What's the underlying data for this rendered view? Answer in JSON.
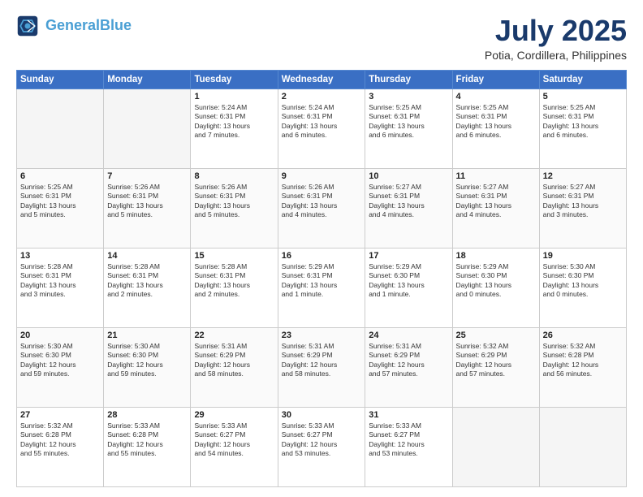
{
  "header": {
    "logo_line1": "General",
    "logo_line2": "Blue",
    "month": "July 2025",
    "location": "Potia, Cordillera, Philippines"
  },
  "days_of_week": [
    "Sunday",
    "Monday",
    "Tuesday",
    "Wednesday",
    "Thursday",
    "Friday",
    "Saturday"
  ],
  "weeks": [
    [
      {
        "day": "",
        "info": ""
      },
      {
        "day": "",
        "info": ""
      },
      {
        "day": "1",
        "info": "Sunrise: 5:24 AM\nSunset: 6:31 PM\nDaylight: 13 hours\nand 7 minutes."
      },
      {
        "day": "2",
        "info": "Sunrise: 5:24 AM\nSunset: 6:31 PM\nDaylight: 13 hours\nand 6 minutes."
      },
      {
        "day": "3",
        "info": "Sunrise: 5:25 AM\nSunset: 6:31 PM\nDaylight: 13 hours\nand 6 minutes."
      },
      {
        "day": "4",
        "info": "Sunrise: 5:25 AM\nSunset: 6:31 PM\nDaylight: 13 hours\nand 6 minutes."
      },
      {
        "day": "5",
        "info": "Sunrise: 5:25 AM\nSunset: 6:31 PM\nDaylight: 13 hours\nand 6 minutes."
      }
    ],
    [
      {
        "day": "6",
        "info": "Sunrise: 5:25 AM\nSunset: 6:31 PM\nDaylight: 13 hours\nand 5 minutes."
      },
      {
        "day": "7",
        "info": "Sunrise: 5:26 AM\nSunset: 6:31 PM\nDaylight: 13 hours\nand 5 minutes."
      },
      {
        "day": "8",
        "info": "Sunrise: 5:26 AM\nSunset: 6:31 PM\nDaylight: 13 hours\nand 5 minutes."
      },
      {
        "day": "9",
        "info": "Sunrise: 5:26 AM\nSunset: 6:31 PM\nDaylight: 13 hours\nand 4 minutes."
      },
      {
        "day": "10",
        "info": "Sunrise: 5:27 AM\nSunset: 6:31 PM\nDaylight: 13 hours\nand 4 minutes."
      },
      {
        "day": "11",
        "info": "Sunrise: 5:27 AM\nSunset: 6:31 PM\nDaylight: 13 hours\nand 4 minutes."
      },
      {
        "day": "12",
        "info": "Sunrise: 5:27 AM\nSunset: 6:31 PM\nDaylight: 13 hours\nand 3 minutes."
      }
    ],
    [
      {
        "day": "13",
        "info": "Sunrise: 5:28 AM\nSunset: 6:31 PM\nDaylight: 13 hours\nand 3 minutes."
      },
      {
        "day": "14",
        "info": "Sunrise: 5:28 AM\nSunset: 6:31 PM\nDaylight: 13 hours\nand 2 minutes."
      },
      {
        "day": "15",
        "info": "Sunrise: 5:28 AM\nSunset: 6:31 PM\nDaylight: 13 hours\nand 2 minutes."
      },
      {
        "day": "16",
        "info": "Sunrise: 5:29 AM\nSunset: 6:31 PM\nDaylight: 13 hours\nand 1 minute."
      },
      {
        "day": "17",
        "info": "Sunrise: 5:29 AM\nSunset: 6:30 PM\nDaylight: 13 hours\nand 1 minute."
      },
      {
        "day": "18",
        "info": "Sunrise: 5:29 AM\nSunset: 6:30 PM\nDaylight: 13 hours\nand 0 minutes."
      },
      {
        "day": "19",
        "info": "Sunrise: 5:30 AM\nSunset: 6:30 PM\nDaylight: 13 hours\nand 0 minutes."
      }
    ],
    [
      {
        "day": "20",
        "info": "Sunrise: 5:30 AM\nSunset: 6:30 PM\nDaylight: 12 hours\nand 59 minutes."
      },
      {
        "day": "21",
        "info": "Sunrise: 5:30 AM\nSunset: 6:30 PM\nDaylight: 12 hours\nand 59 minutes."
      },
      {
        "day": "22",
        "info": "Sunrise: 5:31 AM\nSunset: 6:29 PM\nDaylight: 12 hours\nand 58 minutes."
      },
      {
        "day": "23",
        "info": "Sunrise: 5:31 AM\nSunset: 6:29 PM\nDaylight: 12 hours\nand 58 minutes."
      },
      {
        "day": "24",
        "info": "Sunrise: 5:31 AM\nSunset: 6:29 PM\nDaylight: 12 hours\nand 57 minutes."
      },
      {
        "day": "25",
        "info": "Sunrise: 5:32 AM\nSunset: 6:29 PM\nDaylight: 12 hours\nand 57 minutes."
      },
      {
        "day": "26",
        "info": "Sunrise: 5:32 AM\nSunset: 6:28 PM\nDaylight: 12 hours\nand 56 minutes."
      }
    ],
    [
      {
        "day": "27",
        "info": "Sunrise: 5:32 AM\nSunset: 6:28 PM\nDaylight: 12 hours\nand 55 minutes."
      },
      {
        "day": "28",
        "info": "Sunrise: 5:33 AM\nSunset: 6:28 PM\nDaylight: 12 hours\nand 55 minutes."
      },
      {
        "day": "29",
        "info": "Sunrise: 5:33 AM\nSunset: 6:27 PM\nDaylight: 12 hours\nand 54 minutes."
      },
      {
        "day": "30",
        "info": "Sunrise: 5:33 AM\nSunset: 6:27 PM\nDaylight: 12 hours\nand 53 minutes."
      },
      {
        "day": "31",
        "info": "Sunrise: 5:33 AM\nSunset: 6:27 PM\nDaylight: 12 hours\nand 53 minutes."
      },
      {
        "day": "",
        "info": ""
      },
      {
        "day": "",
        "info": ""
      }
    ]
  ]
}
